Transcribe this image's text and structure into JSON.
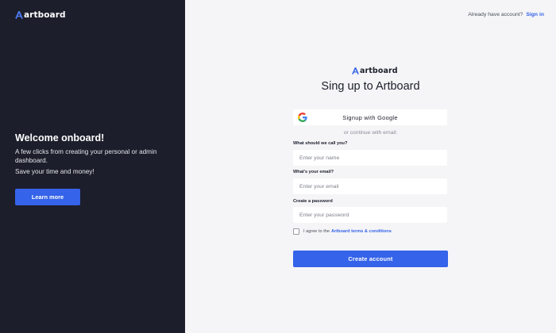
{
  "brand": {
    "name": "artboard"
  },
  "left_panel": {
    "title": "Welcome onboard!",
    "description": "A few clicks from creating your personal or admin dashboard.",
    "tagline": "Save your time and money!",
    "learn_more_label": "Learn more"
  },
  "header": {
    "prompt": "Already have account?",
    "signin_label": "Sign in"
  },
  "form": {
    "title": "Sing up to Artboard",
    "google_label": "Signup with Google",
    "divider_text": "or continue with email:",
    "name": {
      "label": "What should we call you?",
      "placeholder": "Enter your name",
      "value": ""
    },
    "email": {
      "label": "What's your email?",
      "placeholder": "Enter your email",
      "value": ""
    },
    "password": {
      "label": "Create a password",
      "placeholder": "Enter your password",
      "value": ""
    },
    "terms": {
      "prefix": "I agree to the",
      "link": "Artboard terms & conditions",
      "checked": false
    },
    "submit_label": "Create account"
  },
  "colors": {
    "accent": "#3563e9",
    "dark_panel": "#1c1e2b",
    "background": "#f5f5f7"
  },
  "icons": [
    "artboard-logo-icon",
    "google-icon",
    "checkbox-icon"
  ]
}
